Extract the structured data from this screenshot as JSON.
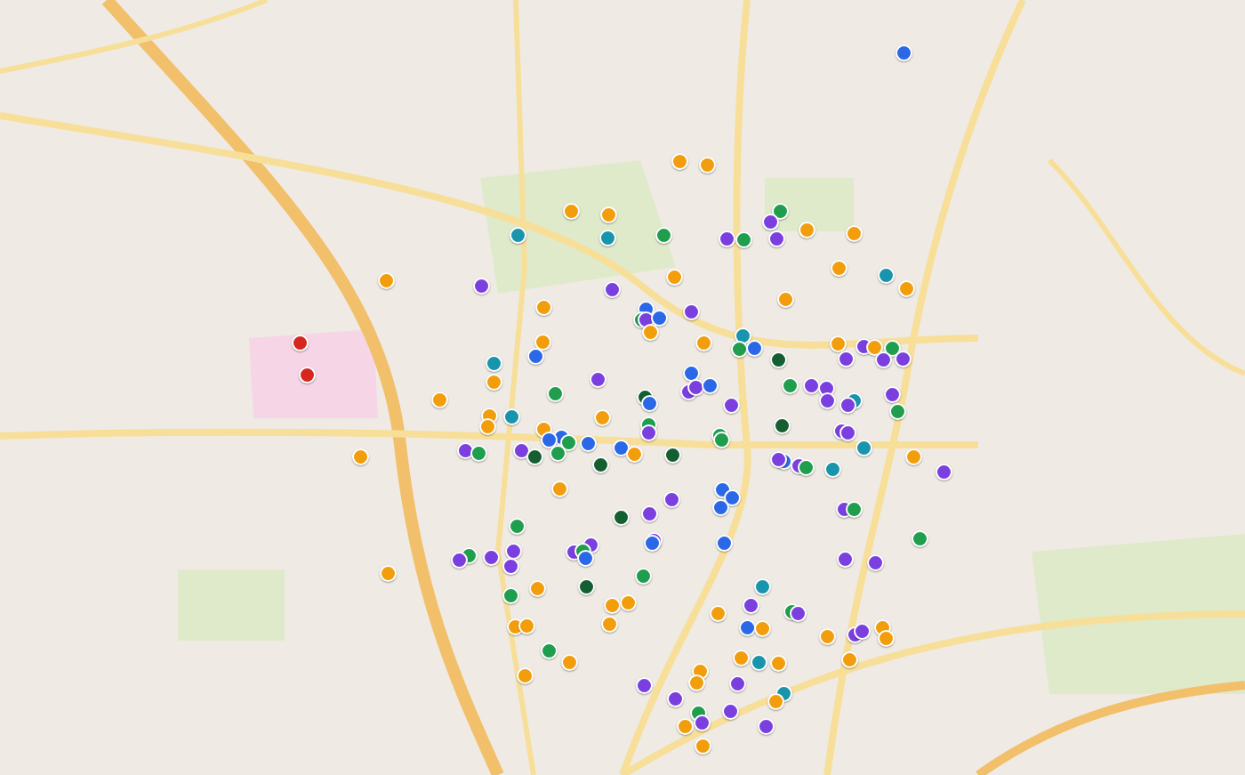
{
  "map": {
    "markers": [
      {
        "color": "#2a68e8"
      },
      {
        "color": "#f29e0c"
      },
      {
        "color": "#f29e0c"
      },
      {
        "color": "#f29e0c"
      },
      {
        "color": "#f29e0c"
      },
      {
        "color": "#1894ad"
      },
      {
        "color": "#1894ad"
      },
      {
        "color": "#1f9e4d"
      },
      {
        "color": "#1f9e4d"
      },
      {
        "color": "#7b3fe0"
      },
      {
        "color": "#7b3fe0"
      },
      {
        "color": "#1f9e4d"
      },
      {
        "color": "#7b3fe0"
      },
      {
        "color": "#f29e0c"
      },
      {
        "color": "#f29e0c"
      },
      {
        "color": "#f29e0c"
      },
      {
        "color": "#7b3fe0"
      },
      {
        "color": "#7b3fe0"
      },
      {
        "color": "#f29e0c"
      },
      {
        "color": "#f29e0c"
      },
      {
        "color": "#1894ad"
      },
      {
        "color": "#f29e0c"
      },
      {
        "color": "#f29e0c"
      },
      {
        "color": "#f29e0c"
      },
      {
        "color": "#2a68e8"
      },
      {
        "color": "#1f9e4d"
      },
      {
        "color": "#7b3fe0"
      },
      {
        "color": "#2a68e8"
      },
      {
        "color": "#f29e0c"
      },
      {
        "color": "#7b3fe0"
      },
      {
        "color": "#f29e0c"
      },
      {
        "color": "#f29e0c"
      },
      {
        "color": "#1894ad"
      },
      {
        "color": "#1f9e4d"
      },
      {
        "color": "#2a68e8"
      },
      {
        "color": "#f29e0c"
      },
      {
        "color": "#7b3fe0"
      },
      {
        "color": "#f29e0c"
      },
      {
        "color": "#1f9e4d"
      },
      {
        "color": "#7b3fe0"
      },
      {
        "color": "#7b3fe0"
      },
      {
        "color": "#7b3fe0"
      },
      {
        "color": "#d7261e"
      },
      {
        "color": "#d7261e"
      },
      {
        "color": "#2a68e8"
      },
      {
        "color": "#1894ad"
      },
      {
        "color": "#f29e0c"
      },
      {
        "color": "#145e32"
      },
      {
        "color": "#7b3fe0"
      },
      {
        "color": "#2a68e8"
      },
      {
        "color": "#7b3fe0"
      },
      {
        "color": "#7b3fe0"
      },
      {
        "color": "#2a68e8"
      },
      {
        "color": "#1f9e4d"
      },
      {
        "color": "#7b3fe0"
      },
      {
        "color": "#7b3fe0"
      },
      {
        "color": "#1894ad"
      },
      {
        "color": "#7b3fe0"
      },
      {
        "color": "#7b3fe0"
      },
      {
        "color": "#f29e0c"
      },
      {
        "color": "#1f9e4d"
      },
      {
        "color": "#145e32"
      },
      {
        "color": "#2a68e8"
      },
      {
        "color": "#7b3fe0"
      },
      {
        "color": "#7b3fe0"
      },
      {
        "color": "#f29e0c"
      },
      {
        "color": "#1894ad"
      },
      {
        "color": "#f29e0c"
      },
      {
        "color": "#145e32"
      },
      {
        "color": "#1f9e4d"
      },
      {
        "color": "#f29e0c"
      },
      {
        "color": "#f29e0c"
      },
      {
        "color": "#1f9e4d"
      },
      {
        "color": "#7b3fe0"
      },
      {
        "color": "#1f9e4d"
      },
      {
        "color": "#1f9e4d"
      },
      {
        "color": "#7b3fe0"
      },
      {
        "color": "#7b3fe0"
      },
      {
        "color": "#2a68e8"
      },
      {
        "color": "#2a68e8"
      },
      {
        "color": "#2a68e8"
      },
      {
        "color": "#1f9e4d"
      },
      {
        "color": "#2a68e8"
      },
      {
        "color": "#f29e0c"
      },
      {
        "color": "#7b3fe0"
      },
      {
        "color": "#1f9e4d"
      },
      {
        "color": "#7b3fe0"
      },
      {
        "color": "#145e32"
      },
      {
        "color": "#1f9e4d"
      },
      {
        "color": "#145e32"
      },
      {
        "color": "#145e32"
      },
      {
        "color": "#2a68e8"
      },
      {
        "color": "#7b3fe0"
      },
      {
        "color": "#7b3fe0"
      },
      {
        "color": "#1f9e4d"
      },
      {
        "color": "#1894ad"
      },
      {
        "color": "#1894ad"
      },
      {
        "color": "#f29e0c"
      },
      {
        "color": "#7b3fe0"
      },
      {
        "color": "#f29e0c"
      },
      {
        "color": "#f29e0c"
      },
      {
        "color": "#2a68e8"
      },
      {
        "color": "#2a68e8"
      },
      {
        "color": "#2a68e8"
      },
      {
        "color": "#7b3fe0"
      },
      {
        "color": "#7b3fe0"
      },
      {
        "color": "#1f9e4d"
      },
      {
        "color": "#145e32"
      },
      {
        "color": "#7b3fe0"
      },
      {
        "color": "#1f9e4d"
      },
      {
        "color": "#1f9e4d"
      },
      {
        "color": "#7b3fe0"
      },
      {
        "color": "#2a68e8"
      },
      {
        "color": "#2a68e8"
      },
      {
        "color": "#7b3fe0"
      },
      {
        "color": "#7b3fe0"
      },
      {
        "color": "#1f9e4d"
      },
      {
        "color": "#2a68e8"
      },
      {
        "color": "#7b3fe0"
      },
      {
        "color": "#7b3fe0"
      },
      {
        "color": "#7b3fe0"
      },
      {
        "color": "#1f9e4d"
      },
      {
        "color": "#7b3fe0"
      },
      {
        "color": "#f29e0c"
      },
      {
        "color": "#1f9e4d"
      },
      {
        "color": "#7b3fe0"
      },
      {
        "color": "#7b3fe0"
      },
      {
        "color": "#f29e0c"
      },
      {
        "color": "#1f9e4d"
      },
      {
        "color": "#145e32"
      },
      {
        "color": "#f29e0c"
      },
      {
        "color": "#f29e0c"
      },
      {
        "color": "#1894ad"
      },
      {
        "color": "#7b3fe0"
      },
      {
        "color": "#1f9e4d"
      },
      {
        "color": "#7b3fe0"
      },
      {
        "color": "#f29e0c"
      },
      {
        "color": "#f29e0c"
      },
      {
        "color": "#f29e0c"
      },
      {
        "color": "#f29e0c"
      },
      {
        "color": "#2a68e8"
      },
      {
        "color": "#f29e0c"
      },
      {
        "color": "#f29e0c"
      },
      {
        "color": "#7b3fe0"
      },
      {
        "color": "#7b3fe0"
      },
      {
        "color": "#f29e0c"
      },
      {
        "color": "#f29e0c"
      },
      {
        "color": "#1f9e4d"
      },
      {
        "color": "#f29e0c"
      },
      {
        "color": "#f29e0c"
      },
      {
        "color": "#f29e0c"
      },
      {
        "color": "#1894ad"
      },
      {
        "color": "#f29e0c"
      },
      {
        "color": "#f29e0c"
      },
      {
        "color": "#f29e0c"
      },
      {
        "color": "#f29e0c"
      },
      {
        "color": "#7b3fe0"
      },
      {
        "color": "#7b3fe0"
      },
      {
        "color": "#1894ad"
      },
      {
        "color": "#f29e0c"
      },
      {
        "color": "#7b3fe0"
      },
      {
        "color": "#1f9e4d"
      },
      {
        "color": "#7b3fe0"
      },
      {
        "color": "#7b3fe0"
      },
      {
        "color": "#f29e0c"
      },
      {
        "color": "#7b3fe0"
      },
      {
        "color": "#f29e0c"
      }
    ]
  }
}
